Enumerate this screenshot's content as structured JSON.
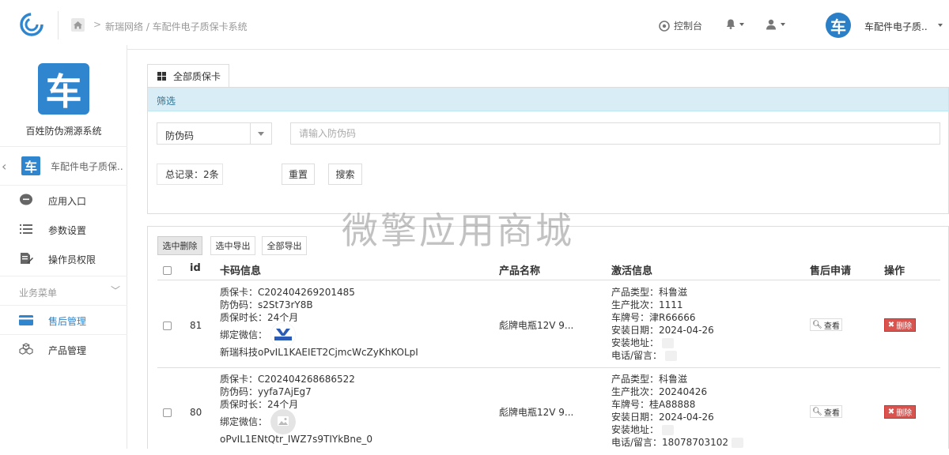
{
  "header": {
    "breadcrumb": "新瑞网络 / 车配件电子质保卡系统",
    "console_label": "控制台",
    "app_name": "车配件电子质...",
    "avatar_char": "车"
  },
  "sidebar": {
    "logo_char": "车",
    "system_name": "百姓防伪溯源系统",
    "current_app": "车配件电子质保...",
    "items": [
      {
        "label": "应用入口"
      },
      {
        "label": "参数设置"
      },
      {
        "label": "操作员权限"
      }
    ],
    "section_label": "业务菜单",
    "business_items": [
      {
        "label": "售后管理"
      },
      {
        "label": "产品管理"
      }
    ],
    "accent_color": "#2f86cf"
  },
  "main": {
    "tab_label": "全部质保卡",
    "filter": {
      "title": "筛选",
      "select_value": "防伪码",
      "search_placeholder": "请输入防伪码",
      "total_label": "总记录：2条",
      "reset_label": "重置",
      "search_label": "搜索"
    },
    "toolbar": {
      "delete_selected": "选中删除",
      "export_selected": "选中导出",
      "export_all": "全部导出"
    },
    "table": {
      "columns": [
        "id",
        "卡码信息",
        "产品名称",
        "激活信息",
        "售后申请",
        "操作"
      ],
      "view_label": "查看",
      "delete_label": "删除",
      "rows": [
        {
          "id": "81",
          "card_no": "质保卡：C202404269201485",
          "anti_fake": "防伪码：s2St73rY8B",
          "duration": "质保时长：24个月",
          "wechat_label": "绑定微信：",
          "wechat_name": "新瑞科技oPvIL1KAEIET2CjmcWcZyKhKOLpI",
          "product": "彪牌电瓶12V 9...",
          "product_type": "产品类型：科鲁滋",
          "batch": "生产批次：1111",
          "plate": "车牌号：津R66666",
          "install_date": "安装日期：2024-04-26",
          "address": "安装地址：",
          "phone": "电话/留言："
        },
        {
          "id": "80",
          "card_no": "质保卡：C202404268686522",
          "anti_fake": "防伪码：yyfa7AjEg7",
          "duration": "质保时长：24个月",
          "wechat_label": "绑定微信：",
          "wechat_name": "oPvIL1ENtQtr_IWZ7s9TIYkBne_0",
          "product": "彪牌电瓶12V 9...",
          "product_type": "产品类型：科鲁滋",
          "batch": "生产批次：20240426",
          "plate": "车牌号：桂A88888",
          "install_date": "安装日期：2024-04-26",
          "address": "安装地址：",
          "phone": "电话/留言：18078703102"
        }
      ]
    }
  },
  "watermark": "微擎应用商城"
}
